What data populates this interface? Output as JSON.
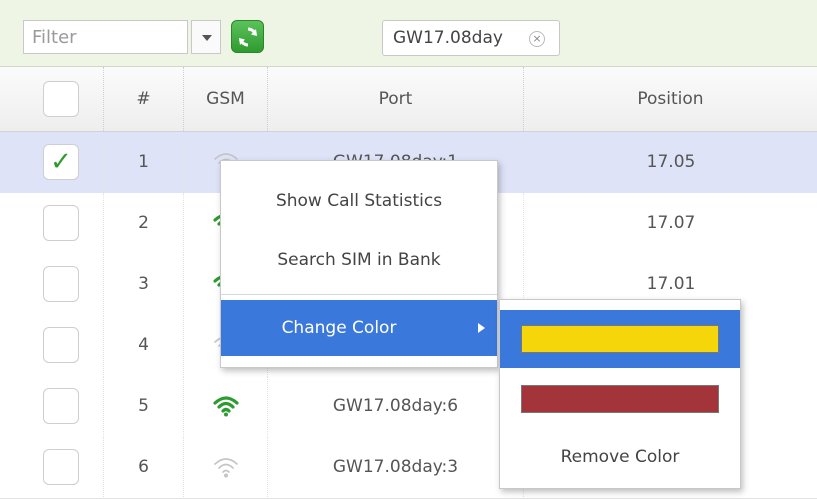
{
  "toolbar": {
    "filter_placeholder": "Filter",
    "tag_label": "GW17.08day",
    "tag_close": "×"
  },
  "grid": {
    "columns": [
      "#",
      "GSM",
      "Port",
      "Position"
    ],
    "rows": [
      {
        "num": "1",
        "gsm": "signal-weak",
        "port": "GW17.08day:1",
        "position": "17.05",
        "checked": true
      },
      {
        "num": "2",
        "gsm": "signal-strong",
        "port": "",
        "position": "17.07",
        "checked": false
      },
      {
        "num": "3",
        "gsm": "signal-strong",
        "port": "",
        "position": "17.01",
        "checked": false
      },
      {
        "num": "4",
        "gsm": "signal-weak",
        "port": "",
        "position": "",
        "checked": false
      },
      {
        "num": "5",
        "gsm": "signal-strong",
        "port": "GW17.08day:6",
        "position": "",
        "checked": false
      },
      {
        "num": "6",
        "gsm": "signal-weak",
        "port": "GW17.08day:3",
        "position": "",
        "checked": false
      }
    ]
  },
  "context_menu": {
    "items": [
      "Show Call Statistics",
      "Search SIM in Bank",
      "Change Color"
    ]
  },
  "color_submenu": {
    "colors": [
      "#f4d60a",
      "#a2343a"
    ],
    "remove_label": "Remove Color"
  },
  "colors": {
    "accent_blue": "#3a78dc",
    "selected_row": "#dfe3f8",
    "signal_green": "#2e9b30",
    "signal_gray": "#c4c4c4",
    "toolbar_bg": "#eef5e4"
  }
}
